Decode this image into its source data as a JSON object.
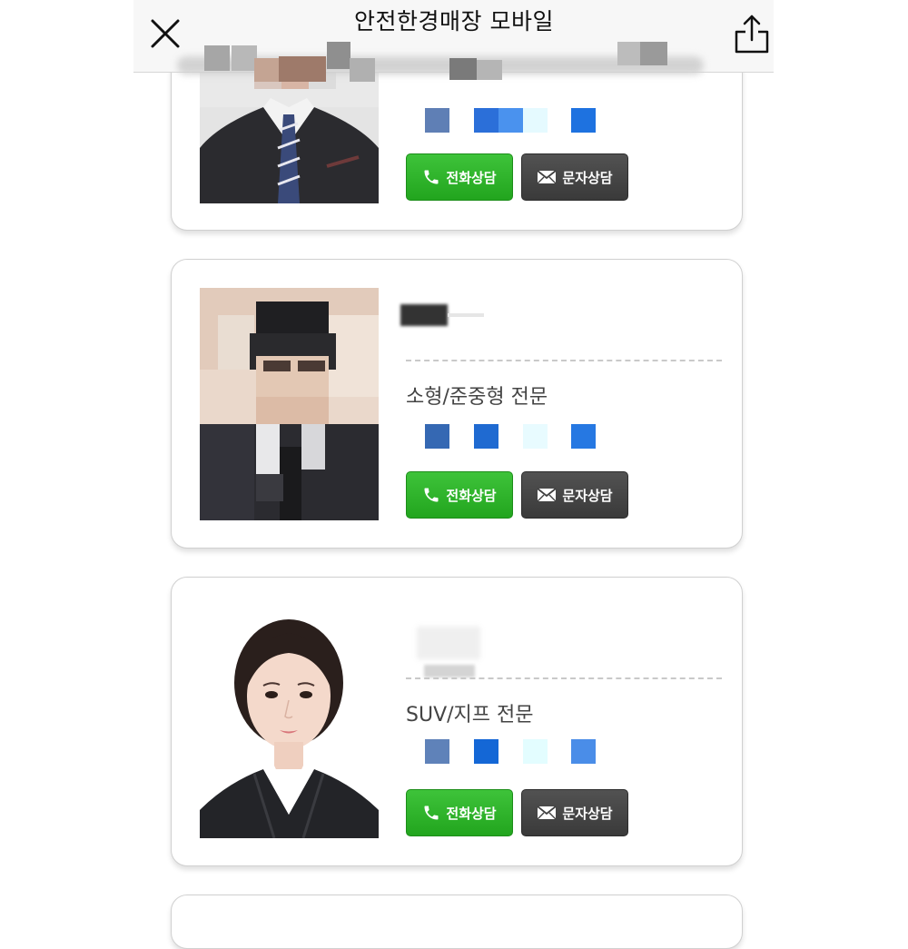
{
  "header": {
    "title": "안전한경매장 모바일",
    "close_icon": "close-icon",
    "share_icon": "share-icon"
  },
  "cards": [
    {
      "specialty": "",
      "call_label": "전화상담",
      "sms_label": "문자상담",
      "photo": "dealer-photo-man-suit-pixelated"
    },
    {
      "specialty": "소형/준중형 전문",
      "call_label": "전화상담",
      "sms_label": "문자상담",
      "photo": "dealer-photo-man-pixelated"
    },
    {
      "specialty": "SUV/지프 전문",
      "call_label": "전화상담",
      "sms_label": "문자상담",
      "photo": "dealer-photo-woman"
    }
  ],
  "colors": {
    "call_button": "#2aae25",
    "sms_button": "#444444",
    "card_border": "#d0d0d0",
    "header_bg": "#f7f7f7"
  },
  "icons": {
    "call": "phone-icon",
    "sms": "envelope-icon"
  }
}
